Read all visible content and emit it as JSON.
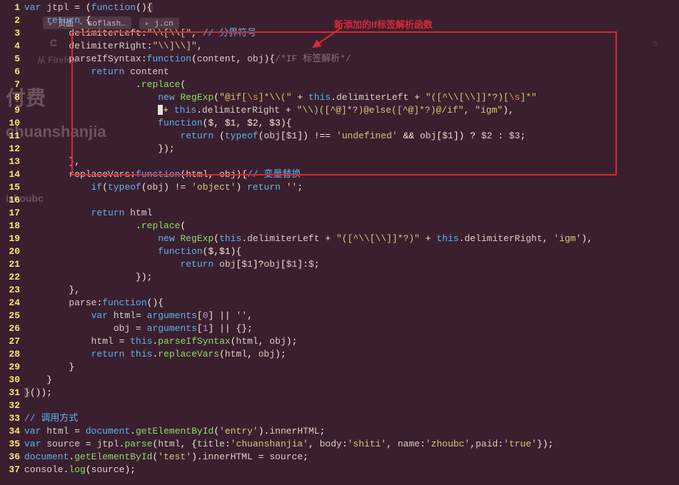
{
  "annotation": {
    "label": "新添加的If标签解析函数"
  },
  "ghost": {
    "title": "付费",
    "name": "chuanshanjia",
    "user": "izhoubc",
    "firefox": "从 Firefox",
    "reload": "C"
  },
  "tabs": {
    "t1": "▹ 页面 - soflash…",
    "t2": "▹ j.cn"
  },
  "lines": {
    "l1": {
      "n": "1"
    },
    "l2": {
      "n": "2"
    },
    "l3": {
      "n": "3",
      "cmt": " 分界符号"
    },
    "l4": {
      "n": "4"
    },
    "l5": {
      "n": "5",
      "cmt": "/*IF 标签解析*/"
    },
    "l6": {
      "n": "6"
    },
    "l7": {
      "n": "7"
    },
    "l8": {
      "n": "8"
    },
    "l9": {
      "n": "9"
    },
    "l10": {
      "n": "10"
    },
    "l11": {
      "n": "11"
    },
    "l12": {
      "n": "12"
    },
    "l13": {
      "n": "13"
    },
    "l14": {
      "n": "14",
      "cmt": " 变量替换"
    },
    "l15": {
      "n": "15"
    },
    "l16": {
      "n": "16"
    },
    "l17": {
      "n": "17"
    },
    "l18": {
      "n": "18"
    },
    "l19": {
      "n": "19"
    },
    "l20": {
      "n": "20"
    },
    "l21": {
      "n": "21"
    },
    "l22": {
      "n": "22"
    },
    "l23": {
      "n": "23"
    },
    "l24": {
      "n": "24"
    },
    "l25": {
      "n": "25"
    },
    "l26": {
      "n": "26"
    },
    "l27": {
      "n": "27"
    },
    "l28": {
      "n": "28"
    },
    "l29": {
      "n": "29"
    },
    "l30": {
      "n": "30"
    },
    "l31": {
      "n": "31"
    },
    "l32": {
      "n": "32"
    },
    "l33": {
      "n": "33",
      "cmt": "// 调用方式"
    },
    "l34": {
      "n": "34"
    },
    "l35": {
      "n": "35"
    },
    "l36": {
      "n": "36"
    },
    "l37": {
      "n": "37"
    }
  },
  "code": {
    "jtpl": "jtpl",
    "content": "content",
    "obj": "obj",
    "html": "html",
    "source": "source",
    "delimiterLeft": "delimiterLeft",
    "delimiterRight": "delimiterRight",
    "parseIfSyntax": "parseIfSyntax",
    "replaceVars": "replaceVars",
    "parse": "parse",
    "replace": "replace",
    "RegExp": "RegExp",
    "arguments": "arguments",
    "innerHTML": "innerHTML",
    "getElementById": "getElementById",
    "document": "document",
    "console": "console",
    "log": "log",
    "s_dl": "\"\\\\[\\\\[\"",
    "s_dr": "\"\\\\]\\\\]\"",
    "s_if1": "\"@if[",
    "s_if2": "]*\\\\(\"",
    "s_if3": "\"([^\\\\[\\\\]]*?)[",
    "s_if4": "]*\"",
    "s_else": "\"\\\\)([^@]*?)@else([^@]*?)@/if\"",
    "s_igm": "\"igm\"",
    "s_rv": "\"([^\\\\[\\\\]]*?)\"",
    "s_undef": "'undefined'",
    "s_obj": "'object'",
    "s_empty": "''",
    "s_entry": "'entry'",
    "s_test": "'test'",
    "s_chuanshanjia": "'chuanshanjia'",
    "s_shiti": "'shiti'",
    "s_zhoubc": "'zhoubc'",
    "s_true": "'true'",
    "p_dollars": "($, $1, $2, $3)",
    "p_dollars2": "($,$1)",
    "bs_s": "\\s",
    "zero": "0",
    "one": "1",
    "dollar": "$",
    "d1": "$1",
    "d2": "$2",
    "d3": "$3",
    "title": "title",
    "body": "body",
    "name": "name",
    "paid": "paid"
  }
}
